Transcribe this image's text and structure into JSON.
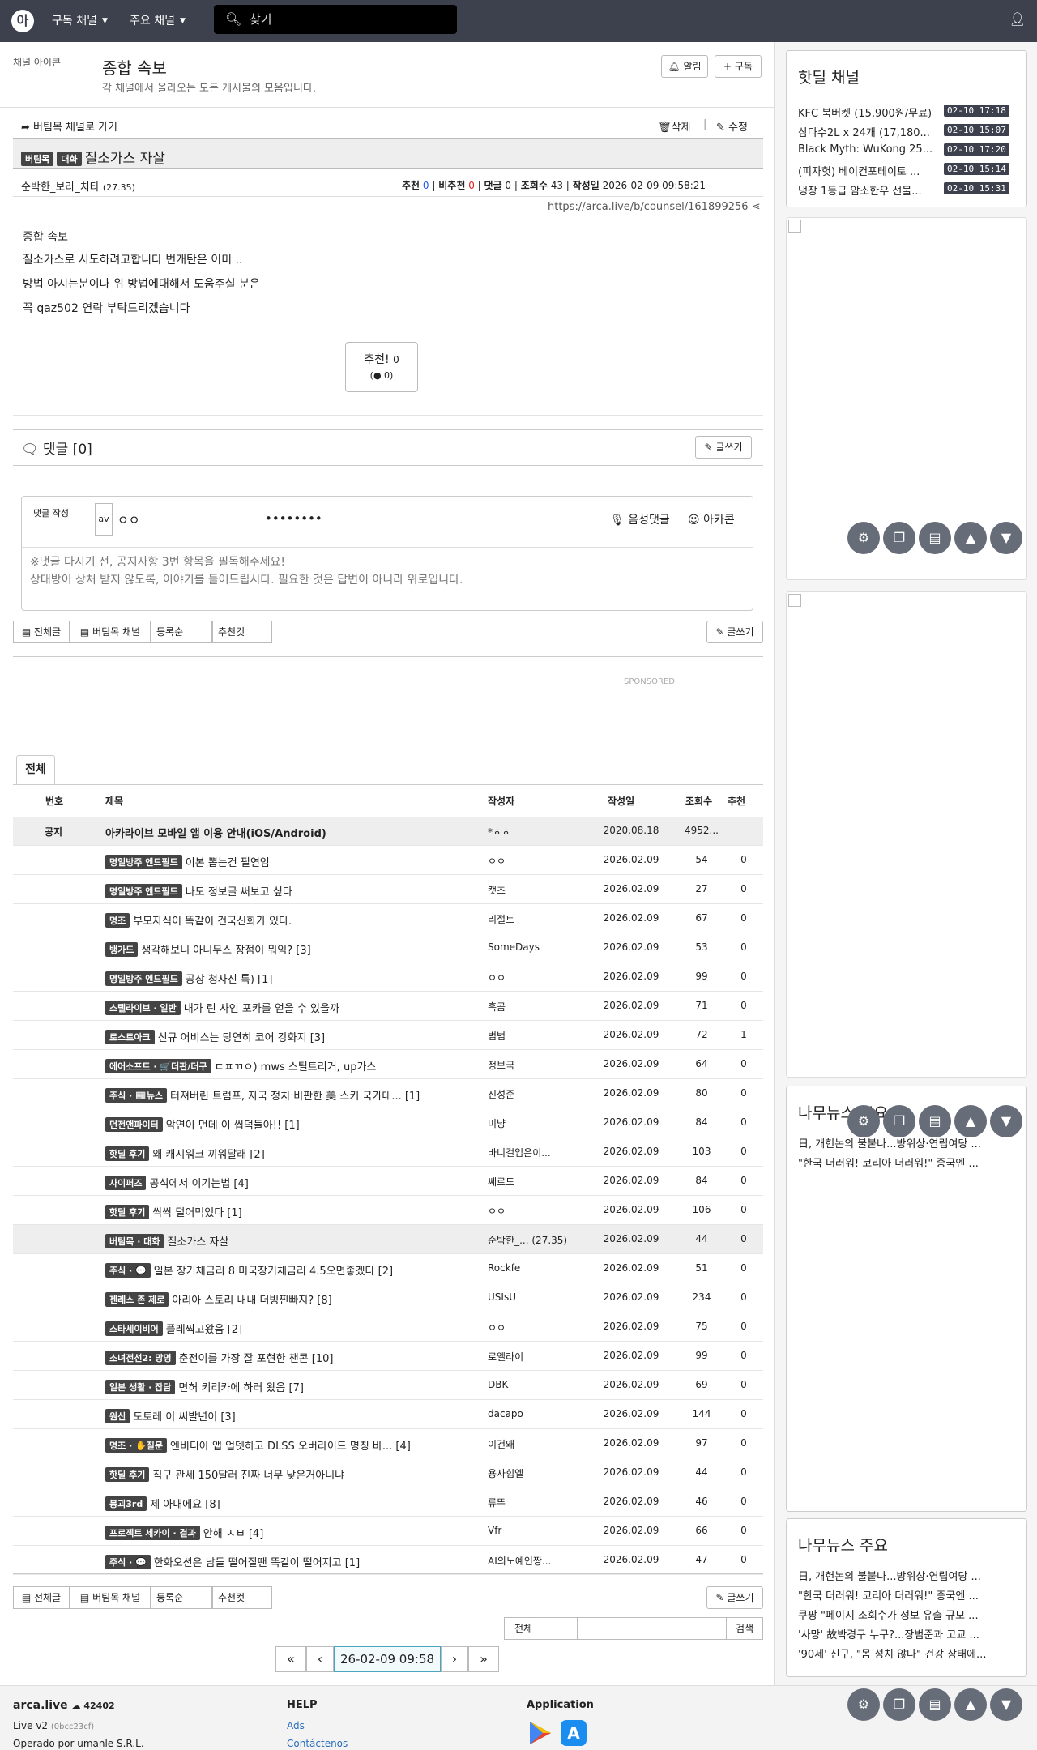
{
  "nav": {
    "logo": "아",
    "menu1": "구독 채널",
    "menu2": "주요 채널",
    "search_placeholder": "찾기"
  },
  "channel": {
    "icon_alt": "채널 아이콘",
    "title": "종합 속보",
    "desc": "각 채널에서 올라오는 모든 게시물의 모음입니다.",
    "alarm": "알림",
    "subscribe": "구독"
  },
  "post": {
    "back": "버팀목 채널로 가기",
    "delete": "삭제",
    "edit": "수정",
    "badge1": "버팀목",
    "badge2": "대화",
    "title": "질소가스 자살",
    "author": "순박한_보라_치타",
    "author_score": "(27.35)",
    "rec_label": "추천",
    "rec": "0",
    "unrec_label": "비추천",
    "unrec": "0",
    "cmt_label": "댓글",
    "cmt": "0",
    "views_label": "조회수",
    "views": "43",
    "date_label": "작성일",
    "date": "2026-02-09 09:58:21",
    "url": "https://arca.live/b/counsel/161899256",
    "img_alt": "종합 속보",
    "body": [
      "질소가스로 시도하려고합니다 번개탄은 이미 ..",
      "방법 아시는분이나 위 방법에대해서 도움주실 분은",
      "꼭 qaz502 연락 부탁드리겠습니다"
    ],
    "rec_btn": "추천!",
    "rec_btn_count": "0",
    "rec_btn_sub": "0"
  },
  "comments": {
    "header": "댓글 [0]",
    "write": "글쓰기",
    "form_label": "댓글 작성",
    "avatar": "av",
    "nick": "ㅇㅇ",
    "password": "••••••••",
    "voice": "음성댓글",
    "arcacon": "아카콘",
    "notice1": "※댓글 다시기 전, 공지사항 3번 항목을 필독해주세요!",
    "notice2": "상대방이 상처 받지 않도록, 이야기를 들어드립시다. 필요한 것은 답변이 아니라 위로입니다."
  },
  "toolbar": {
    "all": "전체글",
    "channel": "버팀목 채널",
    "order": "등록순",
    "best": "추천컷",
    "write": "글쓰기"
  },
  "sponsored": "SPONSORED",
  "board": {
    "tab": "전체",
    "headers": {
      "num": "번호",
      "title": "제목",
      "author": "작성자",
      "date": "작성일",
      "views": "조회수",
      "rec": "추천"
    },
    "rows": [
      {
        "num": "공지",
        "badges": "",
        "title": "아카라이브 모바일 앱 이용 안내(iOS/Android)",
        "author": "*ㅎㅎ",
        "date": "2020.08.18",
        "views": "4952...",
        "rec": ""
      },
      {
        "num": "",
        "badges": "명일방주 엔드필드",
        "title": "이본 뽑는건 필연임",
        "author": "ㅇㅇ",
        "date": "2026.02.09",
        "views": "54",
        "rec": "0"
      },
      {
        "num": "",
        "badges": "명일방주 엔드필드",
        "title": "나도 정보글 써보고 싶다",
        "author": "캣츠",
        "date": "2026.02.09",
        "views": "27",
        "rec": "0"
      },
      {
        "num": "",
        "badges": "명조",
        "title": "부모자식이 똑같이 건국신화가 있다.",
        "author": "리절트",
        "date": "2026.02.09",
        "views": "67",
        "rec": "0"
      },
      {
        "num": "",
        "badges": "뱅가드",
        "title": "생각해보니 아니무스 장점이 뭐임? [3]",
        "author": "SomeDays",
        "date": "2026.02.09",
        "views": "53",
        "rec": "0"
      },
      {
        "num": "",
        "badges": "명일방주 엔드필드",
        "title": "공장 청사진 특) [1]",
        "author": "ㅇㅇ",
        "date": "2026.02.09",
        "views": "99",
        "rec": "0"
      },
      {
        "num": "",
        "badges": "스텔라이브 · 일반",
        "title": "내가 린 사인 포카를 얻을 수 있을까",
        "author": "흑곰",
        "date": "2026.02.09",
        "views": "71",
        "rec": "0"
      },
      {
        "num": "",
        "badges": "로스트아크",
        "title": "신규 어비스는 당연히 코어 강화지 [3]",
        "author": "범범",
        "date": "2026.02.09",
        "views": "72",
        "rec": "1"
      },
      {
        "num": "",
        "badges": "에어소프트 · 🛒더판/더구",
        "title": "ㄷㅍㄲㅇ) mws 스틸트리거, up가스",
        "author": "정보국",
        "date": "2026.02.09",
        "views": "64",
        "rec": "0"
      },
      {
        "num": "",
        "badges": "주식 · 📰뉴스",
        "title": "터져버린 트럼프, 자국 정치 비판한 美 스키 국가대... [1]",
        "author": "진성준",
        "date": "2026.02.09",
        "views": "80",
        "rec": "0"
      },
      {
        "num": "",
        "badges": "던전앤파이터",
        "title": "악연이 먼데 이 씹덕들아!! [1]",
        "author": "미냥",
        "date": "2026.02.09",
        "views": "84",
        "rec": "0"
      },
      {
        "num": "",
        "badges": "핫딜 후기",
        "title": "왜 캐시워크 끼워달래 [2]",
        "author": "바니걸입은이...",
        "date": "2026.02.09",
        "views": "103",
        "rec": "0"
      },
      {
        "num": "",
        "badges": "사이퍼즈",
        "title": "공식에서 이기는법 [4]",
        "author": "쎄르도",
        "date": "2026.02.09",
        "views": "84",
        "rec": "0"
      },
      {
        "num": "",
        "badges": "핫딜 후기",
        "title": "싹싹 털어먹었다 [1]",
        "author": "ㅇㅇ",
        "date": "2026.02.09",
        "views": "106",
        "rec": "0"
      },
      {
        "num": "",
        "badges": "버팀목 · 대화",
        "title": "질소가스 자살",
        "author": "순박한_... (27.35)",
        "date": "2026.02.09",
        "views": "44",
        "rec": "0"
      },
      {
        "num": "",
        "badges": "주식 · 💬",
        "title": "일본 장기채금리 8 미국장기채금리 4.5오면좋겠다 [2]",
        "author": "Rockfe",
        "date": "2026.02.09",
        "views": "51",
        "rec": "0"
      },
      {
        "num": "",
        "badges": "젠레스 존 제로",
        "title": "아리아 스토리 내내 더빙찐빠지? [8]",
        "author": "USIsU",
        "date": "2026.02.09",
        "views": "234",
        "rec": "0"
      },
      {
        "num": "",
        "badges": "스타세이비어",
        "title": "플레찍고왔음 [2]",
        "author": "ㅇㅇ",
        "date": "2026.02.09",
        "views": "75",
        "rec": "0"
      },
      {
        "num": "",
        "badges": "소녀전선2: 망명",
        "title": "춘전이를 가장 잘 포현한 챈콘 [10]",
        "author": "로엘라이",
        "date": "2026.02.09",
        "views": "99",
        "rec": "0"
      },
      {
        "num": "",
        "badges": "일본 생활 · 잡담",
        "title": "면허 키리카에 하러 왔음 [7]",
        "author": "DBK",
        "date": "2026.02.09",
        "views": "69",
        "rec": "0"
      },
      {
        "num": "",
        "badges": "원신",
        "title": "도토레 이 씨발년이 [3]",
        "author": "dacapo",
        "date": "2026.02.09",
        "views": "144",
        "rec": "0"
      },
      {
        "num": "",
        "badges": "명조 · ✋질문",
        "title": "엔비디아 앱 업뎃하고 DLSS 오버라이드 명칭 바... [4]",
        "author": "이건왜",
        "date": "2026.02.09",
        "views": "97",
        "rec": "0"
      },
      {
        "num": "",
        "badges": "핫딜 후기",
        "title": "직구 관세 150달러 진짜 너무 낮은거아니냐",
        "author": "용사힘엘",
        "date": "2026.02.09",
        "views": "44",
        "rec": "0"
      },
      {
        "num": "",
        "badges": "붕괴3rd",
        "title": "제 아내에요 [8]",
        "author": "류뚜",
        "date": "2026.02.09",
        "views": "46",
        "rec": "0"
      },
      {
        "num": "",
        "badges": "프로젝트 세카이 · 결과",
        "title": "안해 ㅅㅂ [4]",
        "author": "Vfr",
        "date": "2026.02.09",
        "views": "66",
        "rec": "0"
      },
      {
        "num": "",
        "badges": "주식 · 💬",
        "title": "한화오션은 남들 떨어질땐 똑같이 떨어지고 [1]",
        "author": "AI의노예인짱...",
        "date": "2026.02.09",
        "views": "47",
        "rec": "0"
      }
    ]
  },
  "search": {
    "select": "전체",
    "button": "검색"
  },
  "pager": {
    "first": "«",
    "prev": "‹",
    "current": "26-02-09 09:58",
    "next": "›",
    "last": "»"
  },
  "hotdeal": {
    "title": "핫딜 채널",
    "items": [
      {
        "t": "KFC 북버켓 (15,900원/무료)",
        "time": "02-10 17:18"
      },
      {
        "t": "삼다수2L x 24개 (17,180...",
        "time": "02-10 15:07"
      },
      {
        "t": "Black Myth: WuKong 25...",
        "time": "02-10 17:20"
      },
      {
        "t": "(피자헛) 베이컨포테이토 ...",
        "time": "02-10 15:14"
      },
      {
        "t": "냉장 1등급 암소한우 선물...",
        "time": "02-10 15:31"
      }
    ]
  },
  "namu1": {
    "title": "나무뉴스 주요",
    "items": [
      "日, 개헌논의 불붙나...방위상·연립여당 ...",
      "\"한국 더러워! 코리아 더러워!\" 중국엔 ..."
    ]
  },
  "namu2": {
    "title": "나무뉴스 주요",
    "items": [
      "日, 개헌논의 불붙나...방위상·연립여당 ...",
      "\"한국 더러워! 코리아 더러워!\" 중국엔 ...",
      "쿠팡 \"페이지 조회수가 정보 유출 규모 ...",
      "'사망' 故박경구 누구?...장범준과 고교 ...",
      "'90세' 신구, \"몸 성치 않다\" 건강 상태에..."
    ]
  },
  "footer": {
    "brand": "arca.live",
    "count": "42402",
    "version": "Live v2",
    "hash": "(0bcc23cf)",
    "operator": "Operado por umanle S.R.L.",
    "help": "HELP",
    "ads": "Ads",
    "contact": "Contáctenos",
    "app": "Application"
  }
}
